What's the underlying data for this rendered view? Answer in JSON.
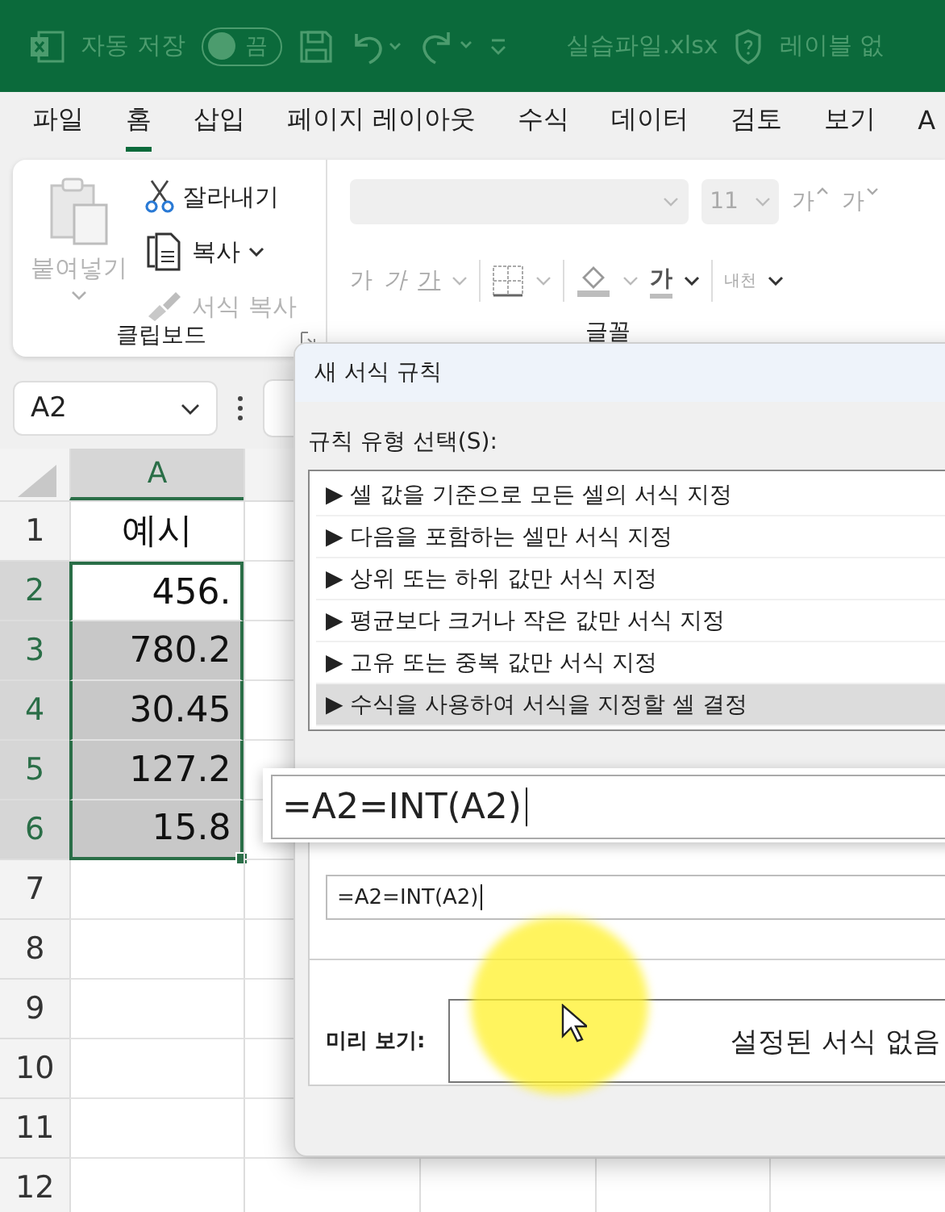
{
  "title_bar": {
    "autosave_label": "자동 저장",
    "autosave_toggle": {
      "label": "끔",
      "on": false
    },
    "file_name": "실습파일.xlsx",
    "sensitivity_label": "레이블 없"
  },
  "menu_tabs": [
    {
      "label": "파일",
      "selected": false
    },
    {
      "label": "홈",
      "selected": true
    },
    {
      "label": "삽입",
      "selected": false
    },
    {
      "label": "페이지 레이아웃",
      "selected": false
    },
    {
      "label": "수식",
      "selected": false
    },
    {
      "label": "데이터",
      "selected": false
    },
    {
      "label": "검토",
      "selected": false
    },
    {
      "label": "보기",
      "selected": false
    },
    {
      "label": "A",
      "selected": false
    }
  ],
  "ribbon": {
    "clipboard": {
      "group_label": "클립보드",
      "items": [
        {
          "kind": "paste",
          "label": "붙여넣기",
          "disabled": true
        },
        {
          "kind": "cut",
          "label": "잘라내기",
          "disabled": false
        },
        {
          "kind": "copy",
          "label": "복사",
          "disabled": false
        },
        {
          "kind": "painter",
          "label": "서식 복사",
          "disabled": true
        }
      ]
    },
    "font": {
      "group_label": "글꼴",
      "size": "11",
      "grow_label": "가",
      "shrink_label": "가",
      "bold_label": "가",
      "italic_label": "가",
      "underline_label": "가",
      "color_label": "가",
      "phonetic_label": "내천"
    }
  },
  "formula_bar": {
    "name_box": "A2"
  },
  "sheet": {
    "columns": [
      {
        "label": "A",
        "selected": true
      }
    ],
    "rows": [
      {
        "header": "1",
        "value": "예시",
        "selected": false
      },
      {
        "header": "2",
        "value": "456.",
        "selected": true,
        "active": true
      },
      {
        "header": "3",
        "value": "780.2",
        "selected": true,
        "active": false
      },
      {
        "header": "4",
        "value": "30.45",
        "selected": true,
        "active": false
      },
      {
        "header": "5",
        "value": "127.2",
        "selected": true,
        "active": false
      },
      {
        "header": "6",
        "value": "15.8",
        "selected": true,
        "active": false
      },
      {
        "header": "7",
        "selected": false
      },
      {
        "header": "8",
        "selected": false
      },
      {
        "header": "9",
        "selected": false
      },
      {
        "header": "10",
        "selected": false
      },
      {
        "header": "11",
        "selected": false
      },
      {
        "header": "12",
        "selected": false
      }
    ]
  },
  "dialog": {
    "title": "새 서식 규칙",
    "rule_type_label": "규칙 유형 선택(S):",
    "rule_types": [
      {
        "label": "▶ 셀 값을 기준으로 모든 셀의 서식 지정",
        "selected": false
      },
      {
        "label": "▶ 다음을 포함하는 셀만 서식 지정",
        "selected": false
      },
      {
        "label": "▶ 상위 또는 하위 값만 서식 지정",
        "selected": false
      },
      {
        "label": "▶ 평균보다 크거나 작은 값만 서식 지정",
        "selected": false
      },
      {
        "label": "▶ 고유 또는 중복 값만 서식 지정",
        "selected": false
      },
      {
        "label": "▶ 수식을 사용하여 서식을 지정할 셀 결정",
        "selected": true
      }
    ],
    "formula": "=A2=INT(A2)",
    "preview_label": "미리 보기:",
    "preview_text": "설정된 서식 없음"
  },
  "zoom_popup": {
    "text": "=A2=INT(A2)"
  }
}
